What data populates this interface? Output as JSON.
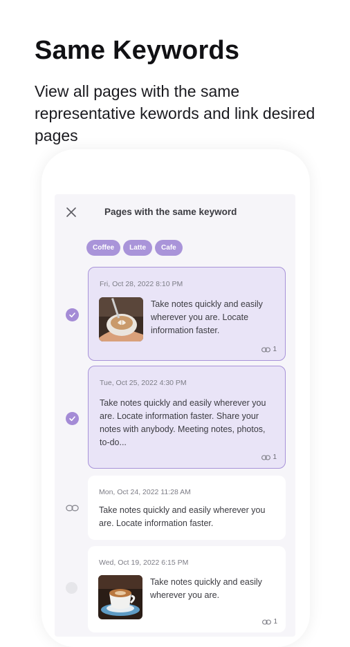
{
  "promo": {
    "title": "Same Keywords",
    "subtitle": "View all pages with the same representative kewords and link desired pages"
  },
  "screen": {
    "title": "Pages with the same keyword",
    "keywords": [
      "Coffee",
      "Latte",
      "Cafe"
    ],
    "pages": [
      {
        "date": "Fri, Oct 28, 2022 8:10 PM",
        "text": "Take notes quickly and easily wherever you are. Locate information faster.",
        "link_count": "1",
        "state": "checked",
        "thumbnail": "latte-art-cup"
      },
      {
        "date": "Tue, Oct 25, 2022 4:30 PM",
        "text": "Take notes quickly and easily wherever you are. Locate information faster. Share your notes with anybody. Meeting notes, photos, to-do...",
        "link_count": "1",
        "state": "checked",
        "thumbnail": null
      },
      {
        "date": "Mon, Oct 24, 2022 11:28 AM",
        "text": "Take notes quickly and easily wherever you are. Locate information faster.",
        "link_count": null,
        "state": "linked",
        "thumbnail": null
      },
      {
        "date": "Wed, Oct 19, 2022 6:15 PM",
        "text": "Take notes quickly and easily wherever you are.",
        "link_count": "1",
        "state": "unchecked",
        "thumbnail": "coffee-cup-saucer"
      }
    ]
  },
  "colors": {
    "accent": "#a48bd6",
    "chip": "#a994d9",
    "selected_card_bg": "#e9e4f7",
    "selected_card_border": "#a792d8",
    "screen_bg": "#f6f5f9"
  },
  "icons": {
    "close": "close-icon",
    "check": "check-icon",
    "link": "link-icon",
    "radio": "radio-empty-icon"
  }
}
